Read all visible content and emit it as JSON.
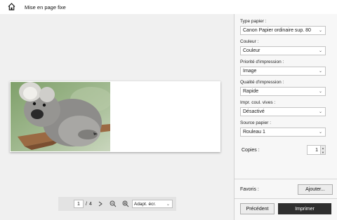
{
  "titlebar": {
    "title": "Mise en page fixe",
    "home_icon": "home-icon"
  },
  "preview": {
    "image": "koala-photo",
    "navigation": {
      "current_page": "1",
      "separator": "/",
      "total_pages": "4",
      "zoom_value": "Adapt. écr."
    }
  },
  "settings": {
    "fields": [
      {
        "label": "Type papier :",
        "value": "Canon Papier ordinaire sup. 80"
      },
      {
        "label": "Couleur :",
        "value": "Couleur"
      },
      {
        "label": "Priorité d'impression :",
        "value": "Image"
      },
      {
        "label": "Qualité d'impression :",
        "value": "Rapide"
      },
      {
        "label": "Impr. coul. vives :",
        "value": "Désactivé"
      },
      {
        "label": "Source papier :",
        "value": "Rouleau 1"
      }
    ],
    "copies": {
      "label": "Copies :",
      "value": "1"
    }
  },
  "favorites": {
    "label": "Favoris :",
    "add_label": "Ajouter..."
  },
  "footer": {
    "previous_label": "Précédent",
    "print_label": "Imprimer",
    "print_color": "#2e2e2e"
  }
}
